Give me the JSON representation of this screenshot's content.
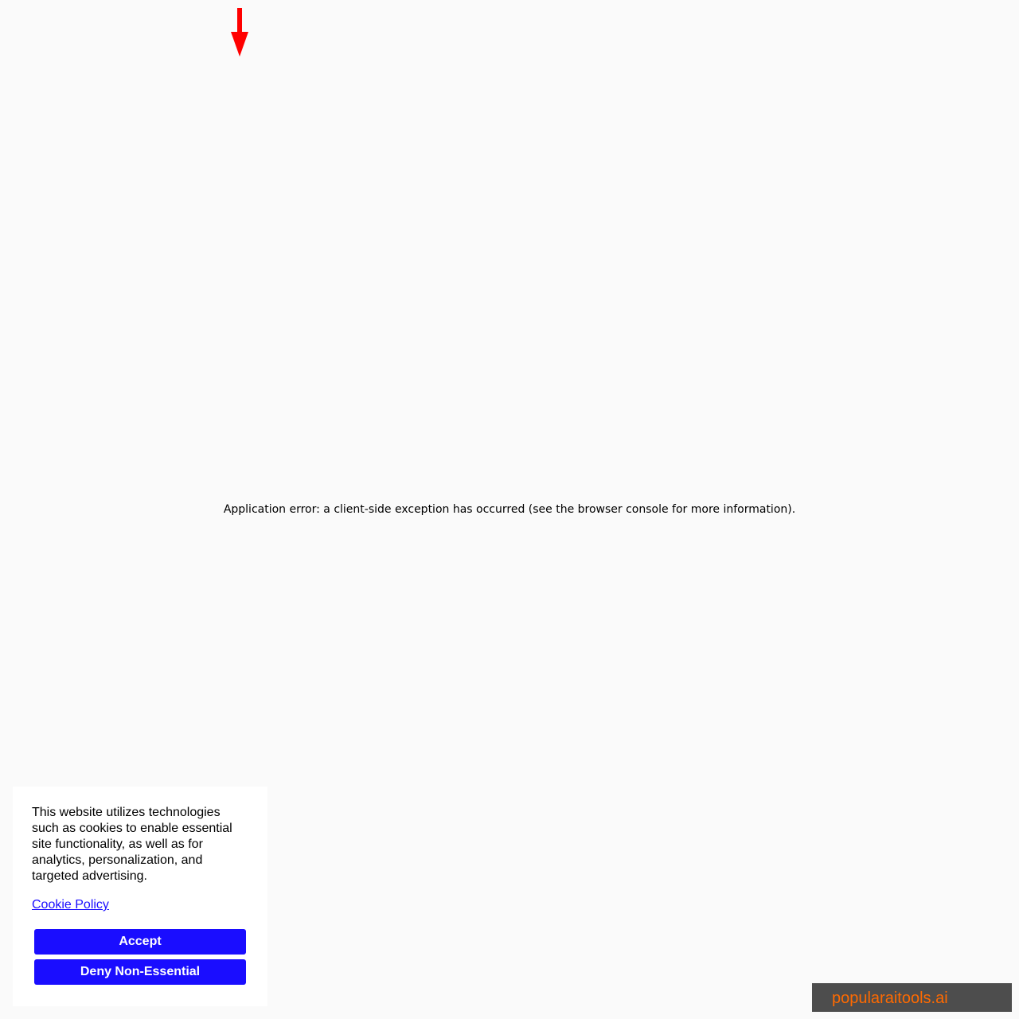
{
  "page": {
    "background_color": "#fafafa"
  },
  "indicator": {
    "icon": "arrow-down-icon",
    "color": "#ff0000"
  },
  "error": {
    "message": "Application error: a client-side exception has occurred (see the browser console for more information)."
  },
  "cookie_banner": {
    "text": "This website utilizes technologies such as cookies to enable essential site functionality, as well as for analytics, personalization, and targeted advertising.",
    "policy_link": "Cookie Policy",
    "accept_label": "Accept",
    "deny_label": "Deny Non-Essential",
    "button_color": "#1a0dff",
    "link_color": "#1a0dff"
  },
  "brand_badge": {
    "label": "popularaitools.ai",
    "text_color": "#ff6a00",
    "background_color": "#4d4d4d"
  }
}
